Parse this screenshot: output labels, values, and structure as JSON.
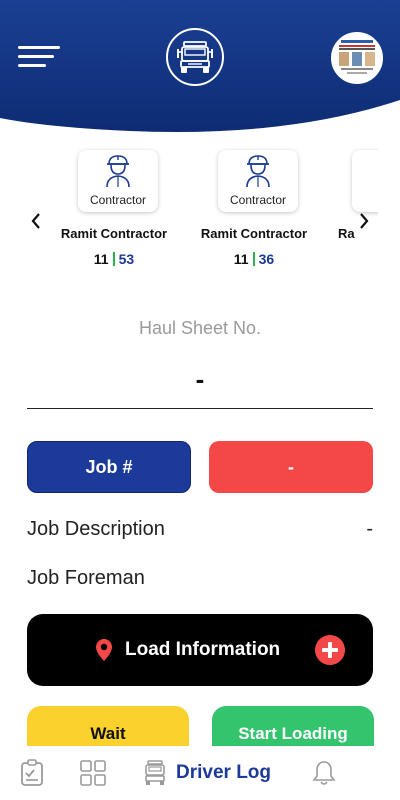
{
  "header": {
    "logo_icon": "truck-icon",
    "menu_icon": "hamburger-menu-icon",
    "brand_color": "#143a8a"
  },
  "contractors": [
    {
      "role": "Contractor",
      "name": "Ramit Contractor",
      "count_a": "11",
      "count_b": "53"
    },
    {
      "role": "Contractor",
      "name": "Ramit Contractor",
      "count_a": "11",
      "count_b": "36"
    },
    {
      "name": "Ra"
    }
  ],
  "haul_sheet": {
    "label": "Haul Sheet No.",
    "value": "-"
  },
  "job": {
    "number_label": "Job #",
    "number_value": "-",
    "description_label": "Job Description",
    "description_value": "-",
    "foreman_label": "Job Foreman"
  },
  "load": {
    "label": "Load Information"
  },
  "actions": {
    "wait_label": "Wait",
    "start_label": "Start Loading"
  },
  "bottom_nav": {
    "active_label": "Driver Log"
  },
  "colors": {
    "accent_blue": "#1c3a9a",
    "accent_red": "#f44848",
    "wait_yellow": "#fbd12d",
    "start_green": "#34c46e"
  }
}
